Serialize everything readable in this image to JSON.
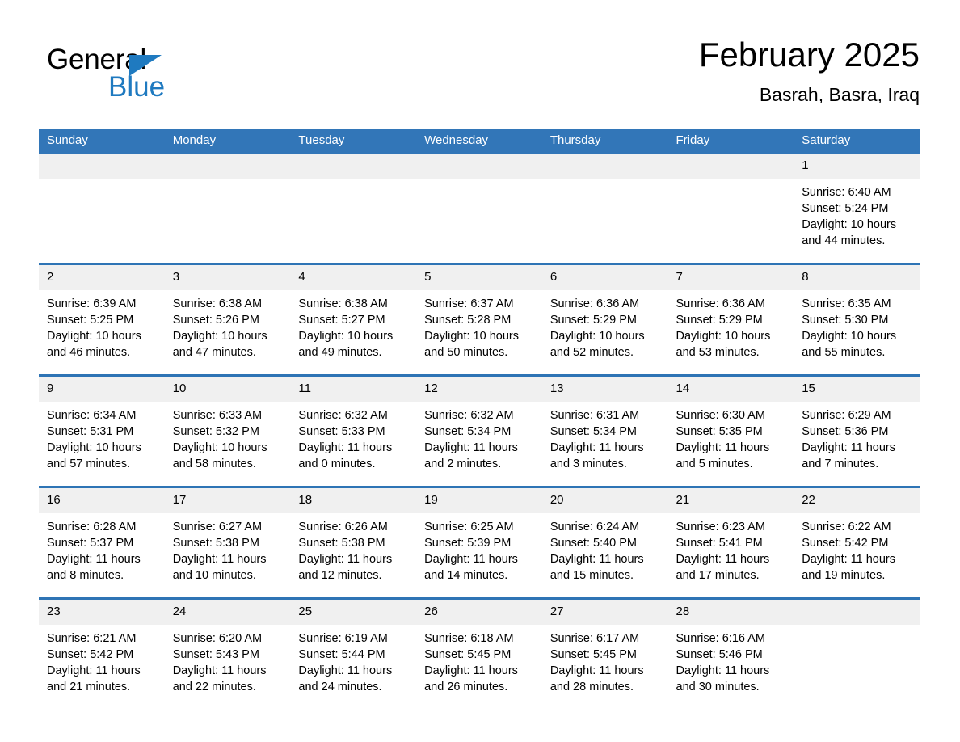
{
  "brand": {
    "name_part1": "General",
    "name_part2": "Blue"
  },
  "header": {
    "title": "February 2025",
    "location": "Basrah, Basra, Iraq"
  },
  "weekdays": [
    "Sunday",
    "Monday",
    "Tuesday",
    "Wednesday",
    "Thursday",
    "Friday",
    "Saturday"
  ],
  "colors": {
    "header_blue": "#3276b8",
    "row_divider_blue": "#2e74b5",
    "daynum_band": "#f0f0f0",
    "brand_blue": "#1f7ac0"
  },
  "weeks": [
    [
      {
        "day": "",
        "blank": true
      },
      {
        "day": "",
        "blank": true
      },
      {
        "day": "",
        "blank": true
      },
      {
        "day": "",
        "blank": true
      },
      {
        "day": "",
        "blank": true
      },
      {
        "day": "",
        "blank": true
      },
      {
        "day": "1",
        "sunrise": "Sunrise: 6:40 AM",
        "sunset": "Sunset: 5:24 PM",
        "daylight": "Daylight: 10 hours and 44 minutes."
      }
    ],
    [
      {
        "day": "2",
        "sunrise": "Sunrise: 6:39 AM",
        "sunset": "Sunset: 5:25 PM",
        "daylight": "Daylight: 10 hours and 46 minutes."
      },
      {
        "day": "3",
        "sunrise": "Sunrise: 6:38 AM",
        "sunset": "Sunset: 5:26 PM",
        "daylight": "Daylight: 10 hours and 47 minutes."
      },
      {
        "day": "4",
        "sunrise": "Sunrise: 6:38 AM",
        "sunset": "Sunset: 5:27 PM",
        "daylight": "Daylight: 10 hours and 49 minutes."
      },
      {
        "day": "5",
        "sunrise": "Sunrise: 6:37 AM",
        "sunset": "Sunset: 5:28 PM",
        "daylight": "Daylight: 10 hours and 50 minutes."
      },
      {
        "day": "6",
        "sunrise": "Sunrise: 6:36 AM",
        "sunset": "Sunset: 5:29 PM",
        "daylight": "Daylight: 10 hours and 52 minutes."
      },
      {
        "day": "7",
        "sunrise": "Sunrise: 6:36 AM",
        "sunset": "Sunset: 5:29 PM",
        "daylight": "Daylight: 10 hours and 53 minutes."
      },
      {
        "day": "8",
        "sunrise": "Sunrise: 6:35 AM",
        "sunset": "Sunset: 5:30 PM",
        "daylight": "Daylight: 10 hours and 55 minutes."
      }
    ],
    [
      {
        "day": "9",
        "sunrise": "Sunrise: 6:34 AM",
        "sunset": "Sunset: 5:31 PM",
        "daylight": "Daylight: 10 hours and 57 minutes."
      },
      {
        "day": "10",
        "sunrise": "Sunrise: 6:33 AM",
        "sunset": "Sunset: 5:32 PM",
        "daylight": "Daylight: 10 hours and 58 minutes."
      },
      {
        "day": "11",
        "sunrise": "Sunrise: 6:32 AM",
        "sunset": "Sunset: 5:33 PM",
        "daylight": "Daylight: 11 hours and 0 minutes."
      },
      {
        "day": "12",
        "sunrise": "Sunrise: 6:32 AM",
        "sunset": "Sunset: 5:34 PM",
        "daylight": "Daylight: 11 hours and 2 minutes."
      },
      {
        "day": "13",
        "sunrise": "Sunrise: 6:31 AM",
        "sunset": "Sunset: 5:34 PM",
        "daylight": "Daylight: 11 hours and 3 minutes."
      },
      {
        "day": "14",
        "sunrise": "Sunrise: 6:30 AM",
        "sunset": "Sunset: 5:35 PM",
        "daylight": "Daylight: 11 hours and 5 minutes."
      },
      {
        "day": "15",
        "sunrise": "Sunrise: 6:29 AM",
        "sunset": "Sunset: 5:36 PM",
        "daylight": "Daylight: 11 hours and 7 minutes."
      }
    ],
    [
      {
        "day": "16",
        "sunrise": "Sunrise: 6:28 AM",
        "sunset": "Sunset: 5:37 PM",
        "daylight": "Daylight: 11 hours and 8 minutes."
      },
      {
        "day": "17",
        "sunrise": "Sunrise: 6:27 AM",
        "sunset": "Sunset: 5:38 PM",
        "daylight": "Daylight: 11 hours and 10 minutes."
      },
      {
        "day": "18",
        "sunrise": "Sunrise: 6:26 AM",
        "sunset": "Sunset: 5:38 PM",
        "daylight": "Daylight: 11 hours and 12 minutes."
      },
      {
        "day": "19",
        "sunrise": "Sunrise: 6:25 AM",
        "sunset": "Sunset: 5:39 PM",
        "daylight": "Daylight: 11 hours and 14 minutes."
      },
      {
        "day": "20",
        "sunrise": "Sunrise: 6:24 AM",
        "sunset": "Sunset: 5:40 PM",
        "daylight": "Daylight: 11 hours and 15 minutes."
      },
      {
        "day": "21",
        "sunrise": "Sunrise: 6:23 AM",
        "sunset": "Sunset: 5:41 PM",
        "daylight": "Daylight: 11 hours and 17 minutes."
      },
      {
        "day": "22",
        "sunrise": "Sunrise: 6:22 AM",
        "sunset": "Sunset: 5:42 PM",
        "daylight": "Daylight: 11 hours and 19 minutes."
      }
    ],
    [
      {
        "day": "23",
        "sunrise": "Sunrise: 6:21 AM",
        "sunset": "Sunset: 5:42 PM",
        "daylight": "Daylight: 11 hours and 21 minutes."
      },
      {
        "day": "24",
        "sunrise": "Sunrise: 6:20 AM",
        "sunset": "Sunset: 5:43 PM",
        "daylight": "Daylight: 11 hours and 22 minutes."
      },
      {
        "day": "25",
        "sunrise": "Sunrise: 6:19 AM",
        "sunset": "Sunset: 5:44 PM",
        "daylight": "Daylight: 11 hours and 24 minutes."
      },
      {
        "day": "26",
        "sunrise": "Sunrise: 6:18 AM",
        "sunset": "Sunset: 5:45 PM",
        "daylight": "Daylight: 11 hours and 26 minutes."
      },
      {
        "day": "27",
        "sunrise": "Sunrise: 6:17 AM",
        "sunset": "Sunset: 5:45 PM",
        "daylight": "Daylight: 11 hours and 28 minutes."
      },
      {
        "day": "28",
        "sunrise": "Sunrise: 6:16 AM",
        "sunset": "Sunset: 5:46 PM",
        "daylight": "Daylight: 11 hours and 30 minutes."
      },
      {
        "day": "",
        "blank": true
      }
    ]
  ]
}
